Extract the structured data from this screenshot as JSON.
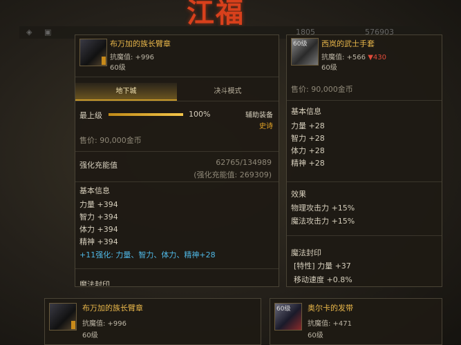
{
  "headline": "江福",
  "bg": {
    "left_num": "1805",
    "right_num": "576903"
  },
  "left_panel": {
    "name": "布万加的族长臂章",
    "resist": "抗魔值: +996",
    "level": "60级",
    "tabs": [
      {
        "label": "地下城"
      },
      {
        "label": "决斗模式"
      }
    ],
    "max_level_label": "最上级",
    "progress_fraction": 1.0,
    "progress_text": "100%",
    "aux_label": "辅助装备",
    "rarity": "史诗",
    "price": "售价: 90,000金币",
    "reinforce_label": "强化充能值",
    "reinforce_value": "62765/134989",
    "reinforce_sub": "(强化充能值: 269309)",
    "basic_info": "基本信息",
    "stats": [
      "力量 +394",
      "智力 +394",
      "体力 +394",
      "精神 +394"
    ],
    "bonus": "+11强化: 力量、智力、体力、精神+28",
    "seal_cut": "魔法封印"
  },
  "right_panel": {
    "icon_level": "60级",
    "name": "西岚的武士手套",
    "resist": "抗魔值: +566",
    "resist_drop": "▼430",
    "level": "60级",
    "price": "售价: 90,000金币",
    "basic_info": "基本信息",
    "stats": [
      "力量 +28",
      "智力 +28",
      "体力 +28",
      "精神 +28"
    ],
    "effect_label": "效果",
    "effects": [
      "物理攻击力 +15%",
      "魔法攻击力 +15%"
    ],
    "seal_label": "魔法封印",
    "seals": [
      "[特性] 力量 +37",
      "移动速度 +0.8%"
    ]
  },
  "bottom_left": {
    "name": "布万加的族长臂章",
    "resist": "抗魔值: +996",
    "level": "60级"
  },
  "bottom_right": {
    "icon_level": "60级",
    "name": "奥尔卡的发带",
    "resist": "抗魔值: +471",
    "level": "60级"
  }
}
